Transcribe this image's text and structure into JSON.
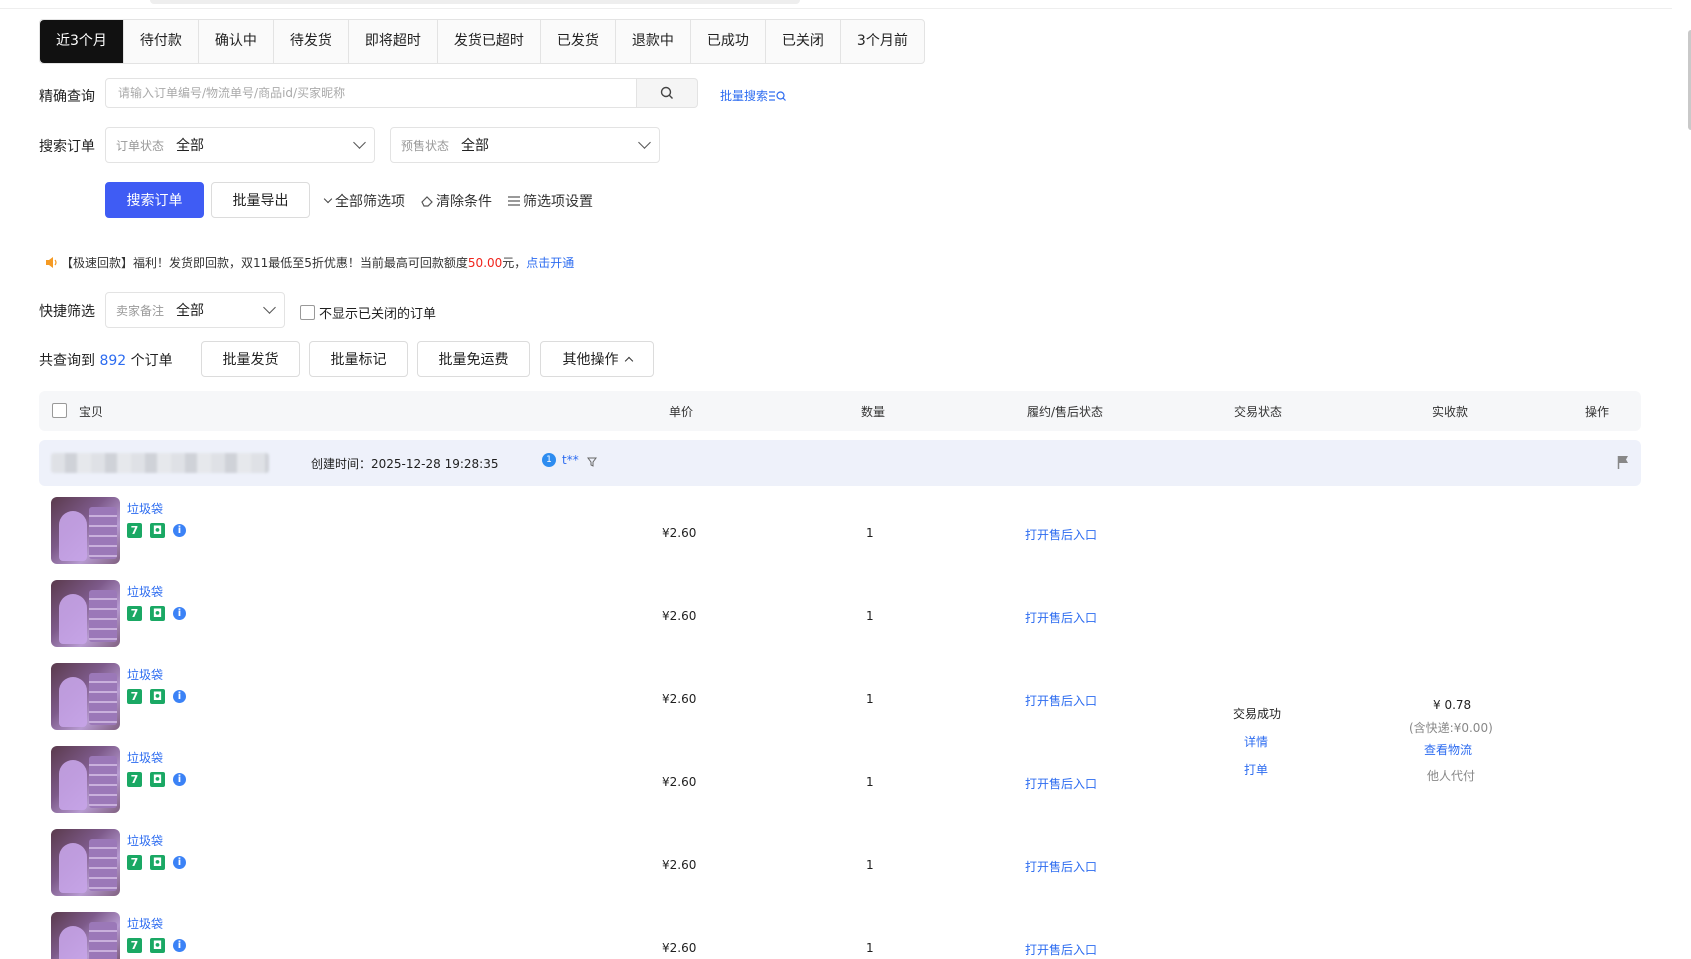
{
  "tabs": [
    "近3个月",
    "待付款",
    "确认中",
    "待发货",
    "即将超时",
    "发货已超时",
    "已发货",
    "退款中",
    "已成功",
    "已关闭",
    "3个月前"
  ],
  "active_tab_index": 0,
  "search": {
    "label": "精确查询",
    "placeholder": "请输入订单编号/物流单号/商品id/买家昵称",
    "batch_search": "批量搜索",
    "batch_search_icon": "list-search-icon"
  },
  "filter": {
    "label": "搜索订单",
    "order_status_label": "订单状态",
    "order_status_value": "全部",
    "presale_status_label": "预售状态",
    "presale_status_value": "全部"
  },
  "actions": {
    "search_button": "搜索订单",
    "export_button": "批量导出",
    "all_filters": "全部筛选项",
    "clear_conditions": "清除条件",
    "filter_settings": "筛选项设置"
  },
  "notice": {
    "prefix": "【极速回款】福利！发货即回款，双11最低至5折优惠！当前最高可回款额度",
    "amount": "50.00",
    "unit": "元，",
    "link": "点击开通"
  },
  "quick_filter": {
    "label": "快捷筛选",
    "seller_note_label": "卖家备注",
    "seller_note_value": "全部",
    "hide_closed_label": "不显示已关闭的订单"
  },
  "summary": {
    "prefix": "共查询到",
    "count": "892",
    "suffix": "个订单"
  },
  "batch": {
    "ship": "批量发货",
    "mark": "批量标记",
    "free_shipping": "批量免运费",
    "other": "其他操作"
  },
  "table_headers": {
    "item": "宝贝",
    "price": "单价",
    "quantity": "数量",
    "fulfillment": "履约/售后状态",
    "trade_status": "交易状态",
    "received": "实收款",
    "operation": "操作"
  },
  "order": {
    "created_label": "创建时间：",
    "created_time": "2025-12-28 19:28:35",
    "buyer": "t**",
    "buyer_badge": "1",
    "trade_status": "交易成功",
    "detail_link": "详情",
    "print_link": "打单",
    "received_amount": "¥ 0.78",
    "shipping_note": "(含快递:¥0.00)",
    "logistics_link": "查看物流",
    "payer_note": "他人代付",
    "items": [
      {
        "title": "垃圾袋",
        "price": "¥2.60",
        "quantity": "1",
        "after_sale": "打开售后入口"
      },
      {
        "title": "垃圾袋",
        "price": "¥2.60",
        "quantity": "1",
        "after_sale": "打开售后入口"
      },
      {
        "title": "垃圾袋",
        "price": "¥2.60",
        "quantity": "1",
        "after_sale": "打开售后入口"
      },
      {
        "title": "垃圾袋",
        "price": "¥2.60",
        "quantity": "1",
        "after_sale": "打开售后入口"
      },
      {
        "title": "垃圾袋",
        "price": "¥2.60",
        "quantity": "1",
        "after_sale": "打开售后入口"
      },
      {
        "title": "垃圾袋",
        "price": "¥2.60",
        "quantity": "1",
        "after_sale": "打开售后入口"
      }
    ]
  },
  "colors": {
    "primary": "#3f5cf4",
    "link": "#2d6cf0",
    "active_tab": "#111111",
    "highlight": "#f0241c",
    "tag_green": "#1aa864"
  }
}
